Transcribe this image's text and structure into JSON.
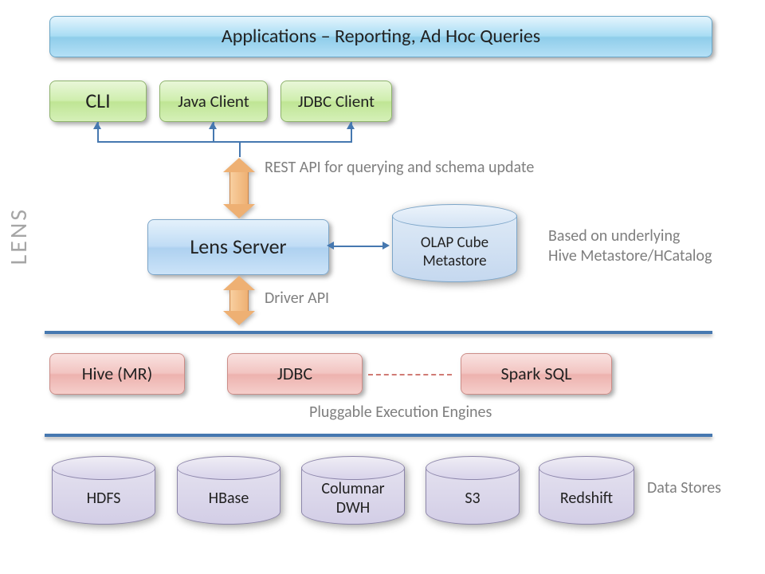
{
  "header": {
    "title": "Applications – Reporting, Ad Hoc Queries"
  },
  "clients": {
    "cli": "CLI",
    "java": "Java Client",
    "jdbc": "JDBC Client"
  },
  "section_label": "LENS",
  "server": {
    "label": "Lens Server"
  },
  "metastore": {
    "line1": "OLAP Cube",
    "line2": "Metastore"
  },
  "annotations": {
    "rest_api": "REST API for querying and schema update",
    "metastore_note_l1": "Based on underlying",
    "metastore_note_l2": "Hive Metastore/HCatalog",
    "driver_api": "Driver API",
    "engines_caption": "Pluggable Execution Engines",
    "stores_caption": "Data Stores"
  },
  "engines": {
    "hive": "Hive (MR)",
    "jdbc": "JDBC",
    "spark": "Spark SQL"
  },
  "stores": {
    "hdfs": "HDFS",
    "hbase": "HBase",
    "columnar_l1": "Columnar",
    "columnar_l2": "DWH",
    "s3": "S3",
    "redshift": "Redshift"
  }
}
